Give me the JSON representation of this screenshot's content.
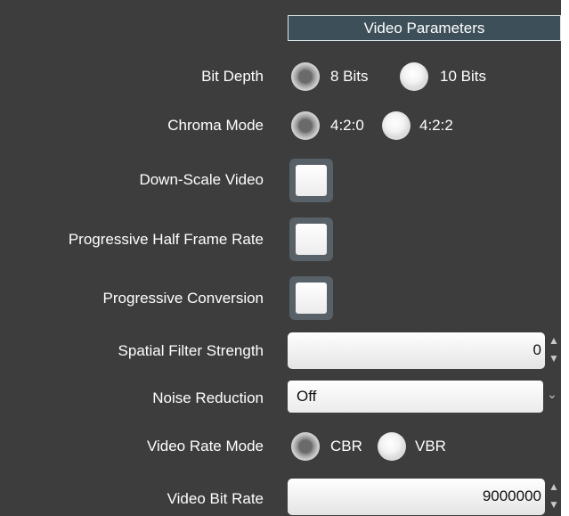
{
  "header": {
    "title": "Video Parameters"
  },
  "bit_depth": {
    "label": "Bit Depth",
    "options": [
      {
        "label": "8 Bits",
        "selected": true
      },
      {
        "label": "10 Bits",
        "selected": false
      }
    ]
  },
  "chroma_mode": {
    "label": "Chroma Mode",
    "options": [
      {
        "label": "4:2:0",
        "selected": true
      },
      {
        "label": "4:2:2",
        "selected": false
      }
    ]
  },
  "down_scale_video": {
    "label": "Down-Scale Video",
    "checked": false
  },
  "progressive_half_frame_rate": {
    "label": "Progressive Half Frame Rate",
    "checked": false
  },
  "progressive_conversion": {
    "label": "Progressive Conversion",
    "checked": false
  },
  "spatial_filter_strength": {
    "label": "Spatial Filter Strength",
    "value": "0"
  },
  "noise_reduction": {
    "label": "Noise Reduction",
    "value": "Off"
  },
  "video_rate_mode": {
    "label": "Video Rate Mode",
    "options": [
      {
        "label": "CBR",
        "selected": true
      },
      {
        "label": "VBR",
        "selected": false
      }
    ]
  },
  "video_bit_rate": {
    "label": "Video Bit Rate",
    "value": "9000000"
  },
  "icons": {
    "spin_up": "▲",
    "spin_down": "▼",
    "dropdown": "⌄"
  },
  "colors": {
    "panel_background": "#3d3d3d",
    "header_background": "#3d4f58",
    "label_text": "#ffffff"
  }
}
